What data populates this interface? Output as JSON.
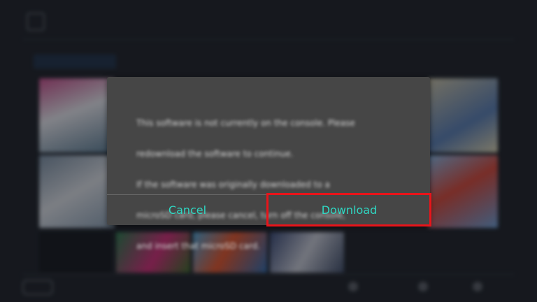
{
  "dialog": {
    "message_lines": [
      "This software is not currently on the console. Please",
      "redownload the software to continue.",
      "If the software was originally downloaded to a",
      "microSD card, please cancel, turn off the console,",
      "and insert that microSD card."
    ],
    "cancel_label": "Cancel",
    "download_label": "Download"
  },
  "colors": {
    "accent_text": "#2fd8c3",
    "highlight_box": "#e8141a",
    "dialog_bg": "#464646"
  }
}
